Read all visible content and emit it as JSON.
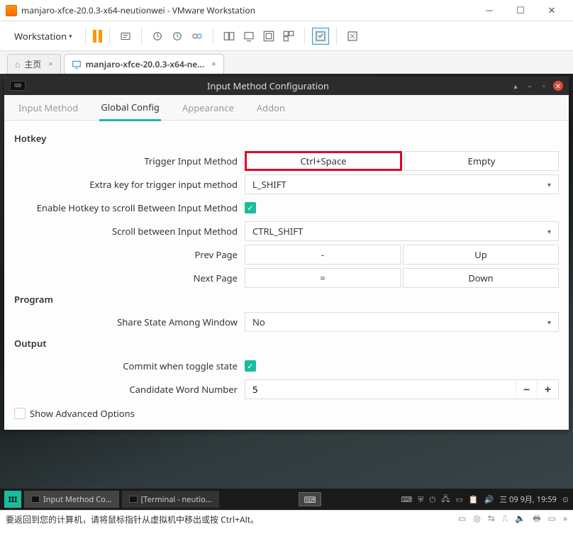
{
  "vmware": {
    "title": "manjaro-xfce-20.0.3-x64-neutionwei - VMware Workstation",
    "menu": "Workstation",
    "tabs": {
      "home": "主页",
      "vm": "manjaro-xfce-20.0.3-x64-ne..."
    }
  },
  "dialog": {
    "title": "Input Method Configuration",
    "tabs": {
      "im": "Input Method",
      "gc": "Global Config",
      "ap": "Appearance",
      "ad": "Addon"
    },
    "sections": {
      "hotkey": "Hotkey",
      "program": "Program",
      "output": "Output"
    },
    "labels": {
      "trigger": "Trigger Input Method",
      "extra": "Extra key for trigger input method",
      "enable_scroll": "Enable Hotkey to scroll Between Input Method",
      "scroll": "Scroll between Input Method",
      "prev": "Prev Page",
      "next": "Next Page",
      "share": "Share State Among Window",
      "commit": "Commit when toggle state",
      "candnum": "Candidate Word Number"
    },
    "values": {
      "trigger1": "Ctrl+Space",
      "trigger2": "Empty",
      "extra": "L_SHIFT",
      "scroll": "CTRL_SHIFT",
      "prev1": "-",
      "prev2": "Up",
      "next1": "=",
      "next2": "Down",
      "share": "No",
      "candnum": "5"
    },
    "show_adv": "Show Advanced Options"
  },
  "taskbar": {
    "item1": "Input Method Co...",
    "item2": "[Terminal - neutio...",
    "clock": "三 09 9月, 19:59"
  },
  "hint": "要返回到您的计算机，请将鼠标指针从虚拟机中移出或按 Ctrl+Alt。"
}
